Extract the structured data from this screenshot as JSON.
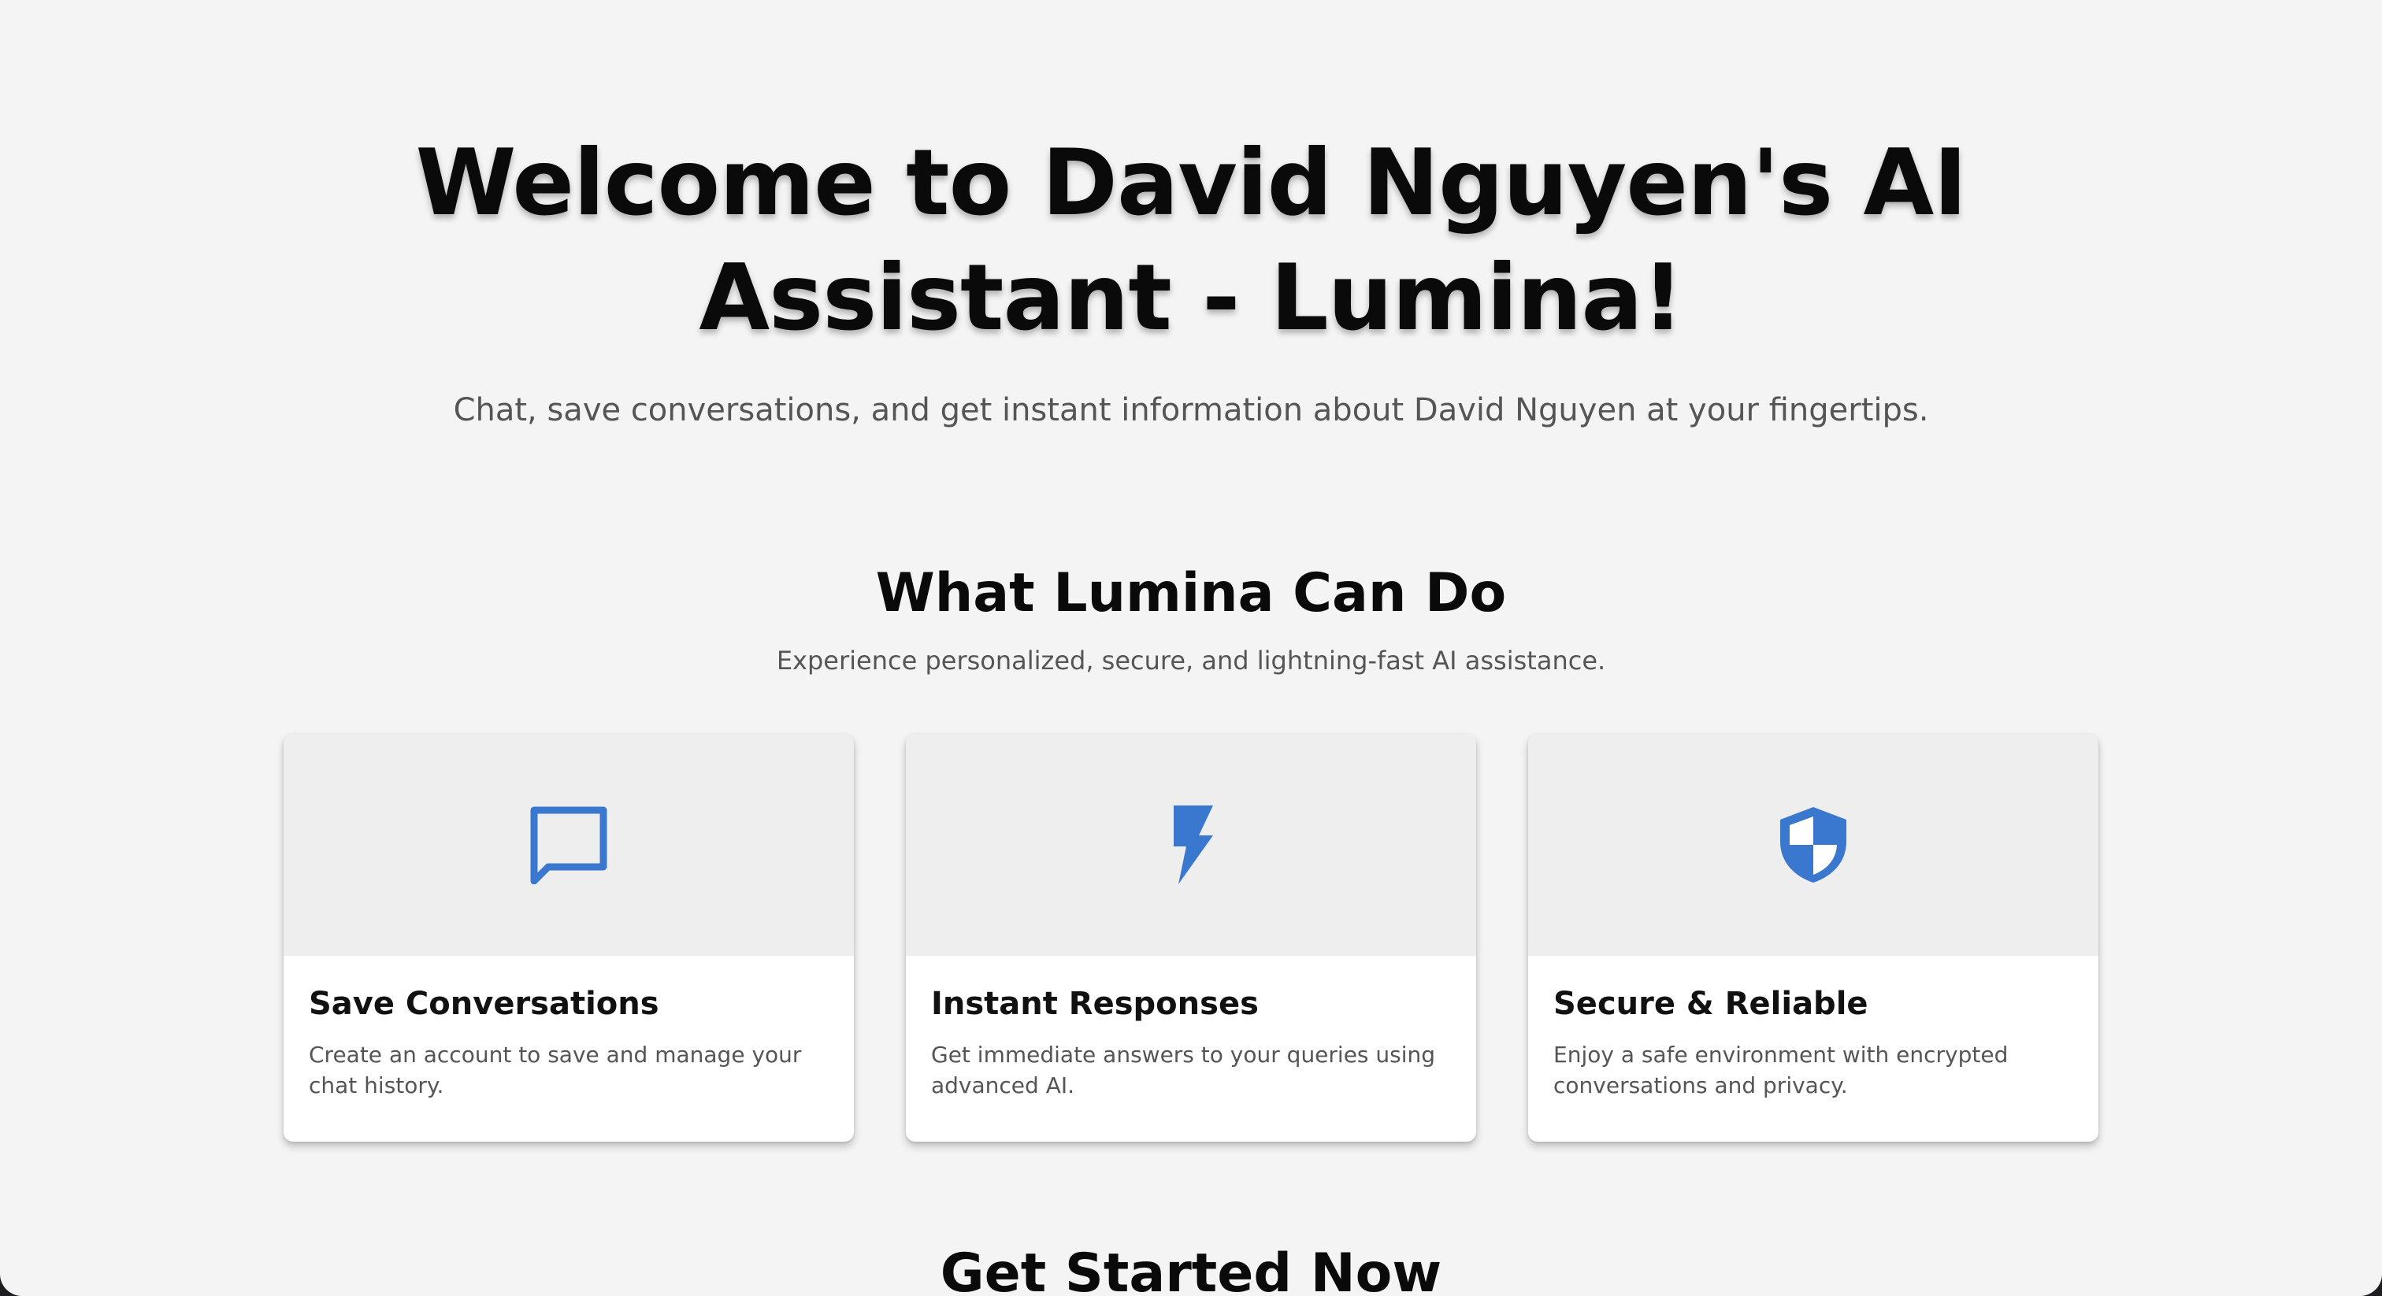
{
  "hero": {
    "title": "Welcome to David Nguyen's AI Assistant - Lumina!",
    "subtitle": "Chat, save conversations, and get instant information about David Nguyen at your fingertips."
  },
  "features": {
    "title": "What Lumina Can Do",
    "subtitle": "Experience personalized, secure, and lightning-fast AI assistance.",
    "cards": [
      {
        "icon": "chat-bubble-icon",
        "title": "Save Conversations",
        "text": "Create an account to save and manage your chat history."
      },
      {
        "icon": "lightning-bolt-icon",
        "title": "Instant Responses",
        "text": "Get immediate answers to your queries using advanced AI."
      },
      {
        "icon": "shield-icon",
        "title": "Secure & Reliable",
        "text": "Enjoy a safe environment with encrypted conversations and privacy."
      }
    ]
  },
  "cta": {
    "title": "Get Started Now"
  },
  "colors": {
    "background": "#f4f4f4",
    "card_media": "#eeeeee",
    "icon_accent": "#3a78d0",
    "heading": "#0a0a0a",
    "muted_text": "#555555"
  }
}
